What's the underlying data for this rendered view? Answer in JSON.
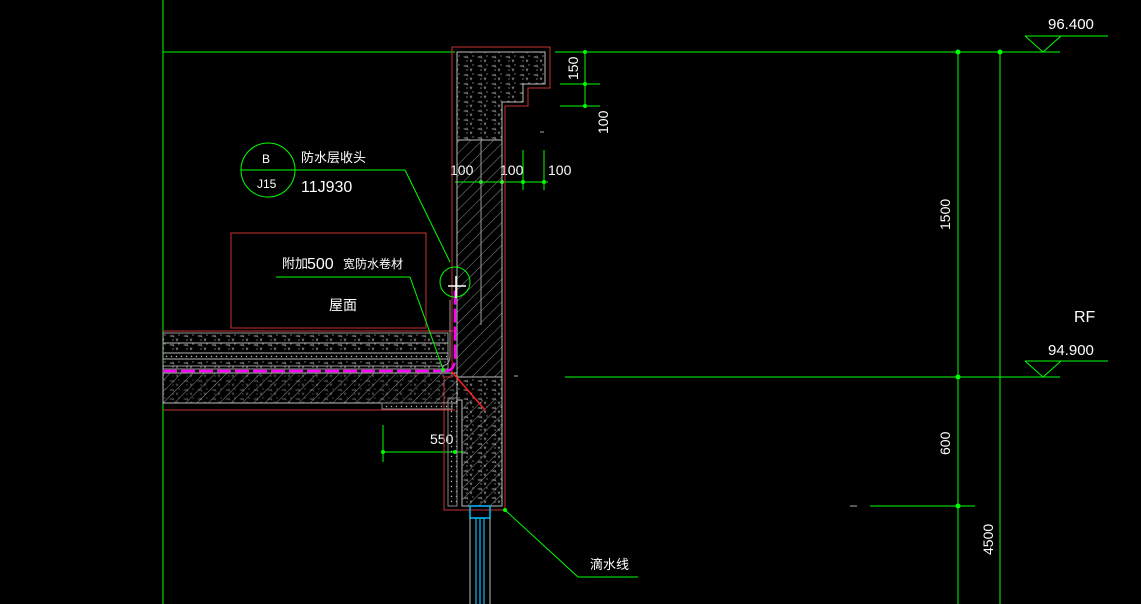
{
  "drawing": {
    "elevations": {
      "top": "96.400",
      "roof": "94.900",
      "level_name": "RF"
    },
    "dimensions": {
      "parapet_cap": "150",
      "cap_step": "100",
      "wall_left": "100",
      "wall_mid": "100",
      "wall_right": "100",
      "parapet_height": "1500",
      "slab_drop": "600",
      "floor_height": "4500",
      "corner_width": "550"
    },
    "callouts": {
      "detail_index": "B",
      "detail_sheet": "J15",
      "detail_title": "防水层收头",
      "detail_atlas": "11J930",
      "extra_membrane_prefix": "附加",
      "extra_membrane_width": "500",
      "extra_membrane_suffix": "宽防水卷材",
      "roof_label": "屋面",
      "drip_label": "滴水线"
    },
    "colors": {
      "background": "#000000",
      "line_green": "#00ff00",
      "outline_red": "#ff0000",
      "membrane_magenta": "#ff00ff",
      "text_white": "#ffffff",
      "window_cyan": "#00bfff"
    }
  }
}
